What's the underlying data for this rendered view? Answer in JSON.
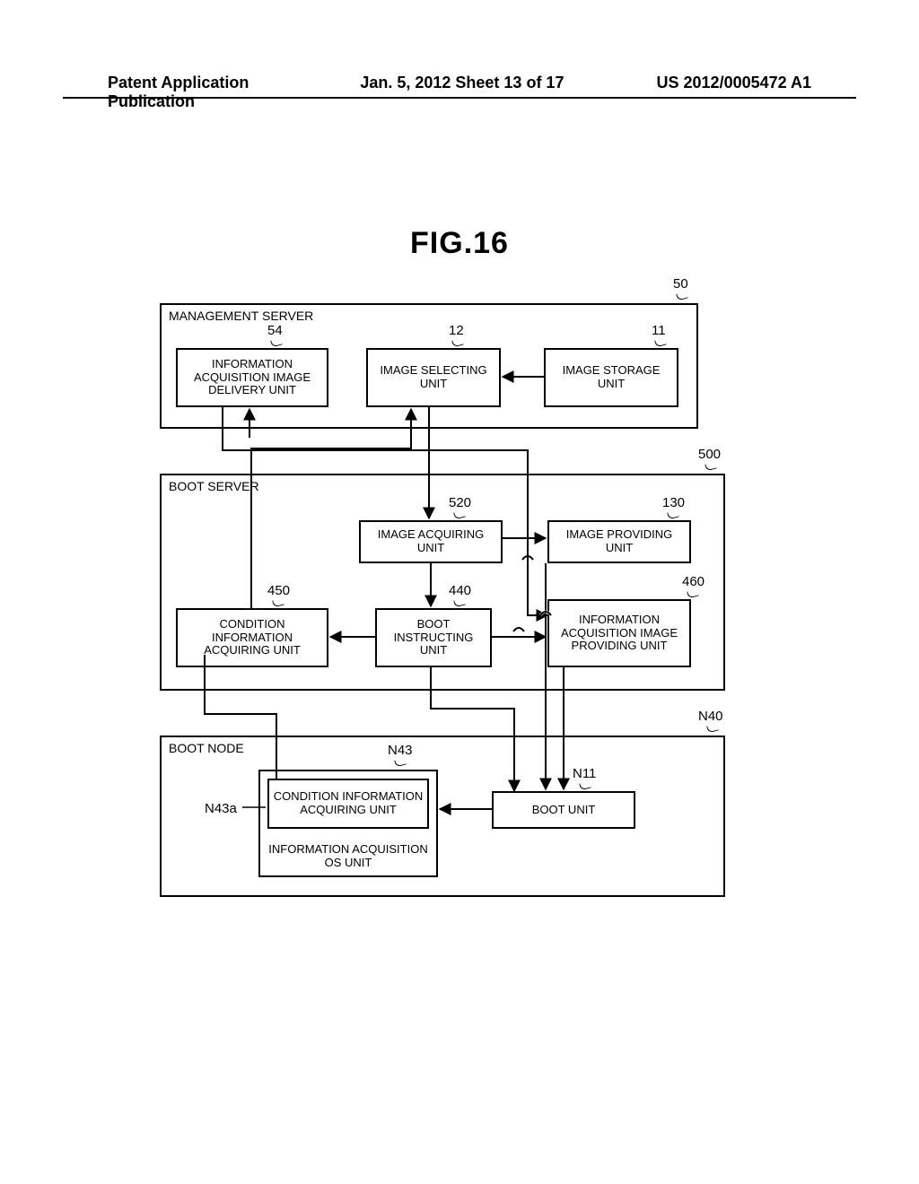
{
  "header": {
    "left": "Patent Application Publication",
    "center": "Jan. 5, 2012   Sheet 13 of 17",
    "right": "US 2012/0005472 A1"
  },
  "figure_title": "FIG.16",
  "refs": {
    "r50": "50",
    "r54": "54",
    "r12": "12",
    "r11": "11",
    "r500": "500",
    "r520": "520",
    "r130": "130",
    "r450": "450",
    "r440": "440",
    "r460": "460",
    "rN40": "N40",
    "rN43": "N43",
    "rN43a": "N43a",
    "rN11": "N11"
  },
  "boxes": {
    "mgmt_title": "MANAGEMENT SERVER",
    "info_acq_img_delivery": "INFORMATION ACQUISITION IMAGE DELIVERY UNIT",
    "image_selecting": "IMAGE SELECTING UNIT",
    "image_storage": "IMAGE STORAGE UNIT",
    "boot_server_title": "BOOT SERVER",
    "image_acquiring": "IMAGE ACQUIRING UNIT",
    "image_providing": "IMAGE PROVIDING UNIT",
    "condition_info_acq": "CONDITION INFORMATION ACQUIRING UNIT",
    "boot_instructing": "BOOT INSTRUCTING UNIT",
    "info_acq_img_providing": "INFORMATION ACQUISITION IMAGE PROVIDING UNIT",
    "boot_node_title": "BOOT NODE",
    "cond_info_acq_node": "CONDITION INFORMATION ACQUIRING UNIT",
    "info_acq_os": "INFORMATION ACQUISITION OS UNIT",
    "boot_unit": "BOOT UNIT"
  }
}
